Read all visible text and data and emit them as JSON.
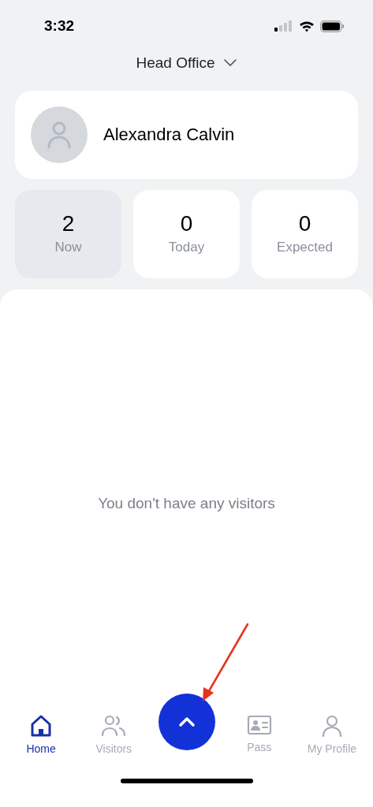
{
  "status_bar": {
    "time": "3:32"
  },
  "location": {
    "label": "Head Office"
  },
  "profile": {
    "name": "Alexandra Calvin"
  },
  "stats": [
    {
      "value": "2",
      "label": "Now",
      "selected": true
    },
    {
      "value": "0",
      "label": "Today",
      "selected": false
    },
    {
      "value": "0",
      "label": "Expected",
      "selected": false
    }
  ],
  "empty_message": "You don't have any visitors",
  "nav": [
    {
      "kind": "tab",
      "label": "Home",
      "selected": true
    },
    {
      "kind": "tab",
      "label": "Visitors",
      "selected": false
    },
    {
      "kind": "action"
    },
    {
      "kind": "tab",
      "label": "Pass",
      "selected": false
    },
    {
      "kind": "tab",
      "label": "My Profile",
      "selected": false
    }
  ]
}
